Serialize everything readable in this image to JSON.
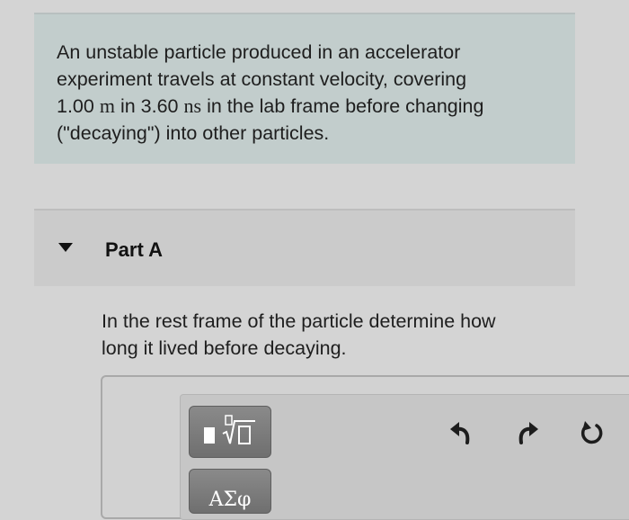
{
  "problem": {
    "line1": "An unstable particle produced in an accelerator",
    "line2": "experiment travels at constant velocity, covering",
    "distance_value": "1.00",
    "distance_unit": "m",
    "mid_text": "in",
    "time_value": "3.60",
    "time_unit": "ns",
    "line3_tail": "in the lab frame before changing",
    "line4": "(\"decaying\") into other particles."
  },
  "part": {
    "title": "Part A",
    "question_line1": "In the rest frame of the particle determine how",
    "question_line2": "long it lived before decaying."
  },
  "toolbar": {
    "symbols_label": "ΑΣφ",
    "icons": [
      "templates-icon",
      "undo-icon",
      "redo-icon",
      "reset-icon"
    ]
  }
}
